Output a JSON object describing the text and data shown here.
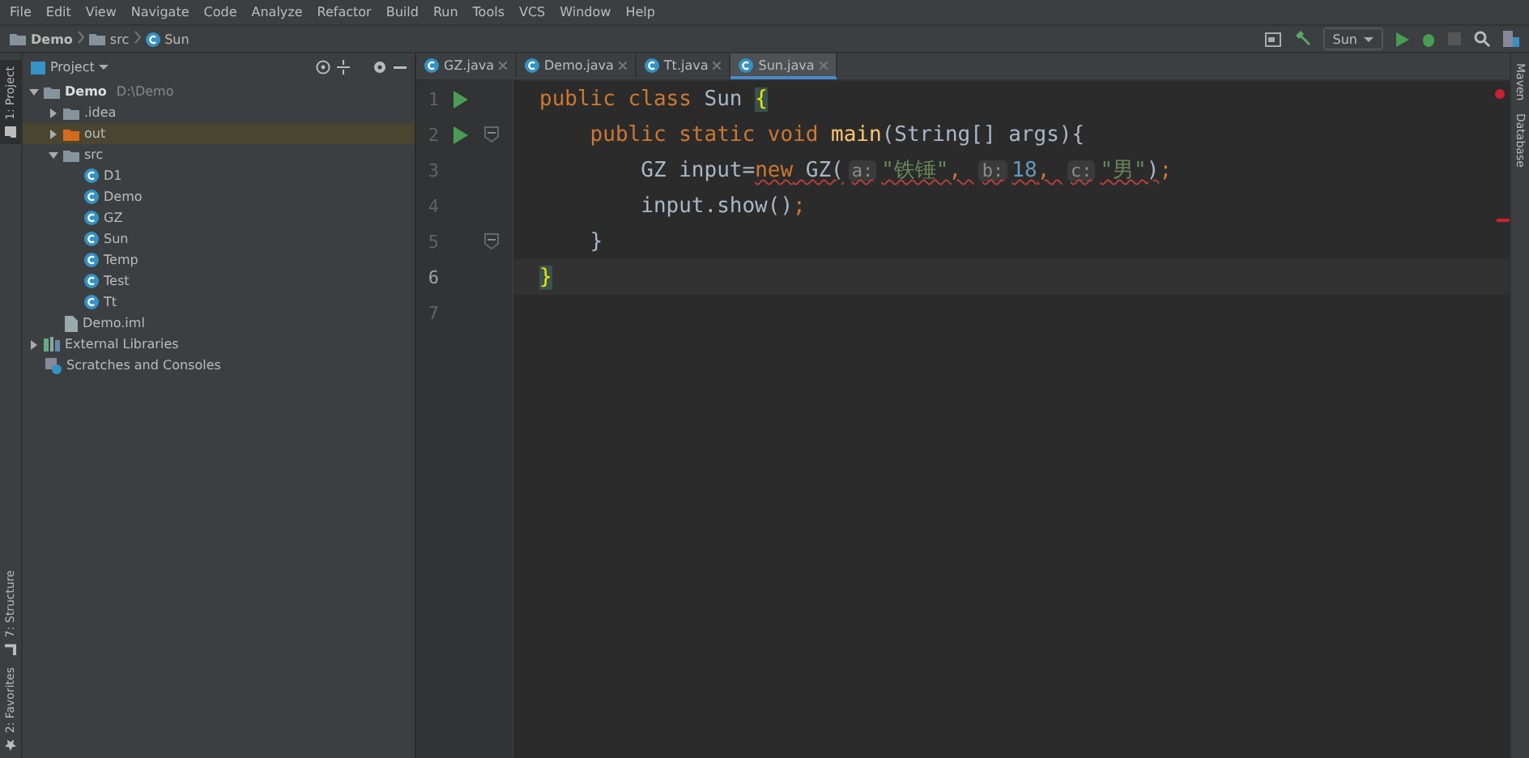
{
  "menu": [
    "File",
    "Edit",
    "View",
    "Navigate",
    "Code",
    "Analyze",
    "Refactor",
    "Build",
    "Run",
    "Tools",
    "VCS",
    "Window",
    "Help"
  ],
  "breadcrumb": [
    {
      "label": "Demo",
      "kind": "module"
    },
    {
      "label": "src",
      "kind": "folder"
    },
    {
      "label": "Sun",
      "kind": "class"
    }
  ],
  "run_config": "Sun",
  "left_stripe": [
    {
      "label": "1: Project",
      "selected": true,
      "kind": "project"
    },
    {
      "label": "7: Structure",
      "selected": false,
      "kind": "structure"
    },
    {
      "label": "2: Favorites",
      "selected": false,
      "kind": "favorites"
    }
  ],
  "right_stripe": [
    "Maven",
    "Database"
  ],
  "project_panel": {
    "title": "Project",
    "tree": [
      {
        "label": "Demo",
        "path": "D:\\Demo",
        "kind": "module",
        "expanded": true,
        "selected": false,
        "children": [
          {
            "label": ".idea",
            "kind": "folder",
            "expanded": false,
            "selected": false
          },
          {
            "label": "out",
            "kind": "excluded",
            "expanded": false,
            "selected": true
          },
          {
            "label": "src",
            "kind": "folder",
            "expanded": true,
            "selected": false,
            "children": [
              {
                "label": "D1",
                "kind": "class",
                "selected": false
              },
              {
                "label": "Demo",
                "kind": "class",
                "selected": false
              },
              {
                "label": "GZ",
                "kind": "class",
                "selected": false
              },
              {
                "label": "Sun",
                "kind": "class",
                "selected": false
              },
              {
                "label": "Temp",
                "kind": "class",
                "selected": false
              },
              {
                "label": "Test",
                "kind": "class",
                "selected": false
              },
              {
                "label": "Tt",
                "kind": "class",
                "selected": false
              }
            ]
          },
          {
            "label": "Demo.iml",
            "kind": "file",
            "selected": false
          }
        ]
      },
      {
        "label": "External Libraries",
        "kind": "library",
        "expanded": false,
        "selected": false
      },
      {
        "label": "Scratches and Consoles",
        "kind": "scratches",
        "selected": false
      }
    ]
  },
  "tabs": [
    {
      "label": "GZ.java",
      "selected": false
    },
    {
      "label": "Demo.java",
      "selected": false
    },
    {
      "label": "Tt.java",
      "selected": false
    },
    {
      "label": "Sun.java",
      "selected": true
    }
  ],
  "editor": {
    "lines": [
      {
        "number": "1",
        "run": true,
        "fold": false,
        "current": false,
        "tokens": [
          {
            "kind": "keyword",
            "text": "public class "
          },
          {
            "kind": "plain",
            "text": "Sun "
          },
          {
            "kind": "brace",
            "text": "{"
          }
        ]
      },
      {
        "number": "2",
        "run": true,
        "fold": true,
        "current": false,
        "tokens": [
          {
            "kind": "keyword",
            "text": "    public static void "
          },
          {
            "kind": "method",
            "text": "main"
          },
          {
            "kind": "plain",
            "text": "(String[] args){"
          }
        ]
      },
      {
        "number": "3",
        "run": false,
        "fold": false,
        "current": false,
        "tokens": [
          {
            "kind": "plain",
            "text": "        GZ input="
          },
          {
            "kind": "keyword",
            "text": "new",
            "error": true
          },
          {
            "kind": "plain",
            "text": " GZ(",
            "error": true
          },
          {
            "kind": "hint",
            "text": "a:",
            "error": true
          },
          {
            "kind": "string",
            "text": "\"铁锤\"",
            "error": true
          },
          {
            "kind": "keyword",
            "text": ", ",
            "error": true
          },
          {
            "kind": "hint",
            "text": "b:",
            "error": true
          },
          {
            "kind": "number",
            "text": "18",
            "error": true
          },
          {
            "kind": "keyword",
            "text": ", ",
            "error": true
          },
          {
            "kind": "hint",
            "text": "c:",
            "error": true
          },
          {
            "kind": "string",
            "text": "\"男\"",
            "error": true
          },
          {
            "kind": "plain",
            "text": ")",
            "error": true
          },
          {
            "kind": "keyword",
            "text": ";"
          }
        ]
      },
      {
        "number": "4",
        "run": false,
        "fold": false,
        "current": false,
        "tokens": [
          {
            "kind": "plain",
            "text": "        input.show()"
          },
          {
            "kind": "keyword",
            "text": ";"
          }
        ]
      },
      {
        "number": "5",
        "run": false,
        "fold": true,
        "current": false,
        "tokens": [
          {
            "kind": "plain",
            "text": "    }"
          }
        ]
      },
      {
        "number": "6",
        "run": false,
        "fold": false,
        "current": true,
        "tokens": [
          {
            "kind": "brace",
            "text": "}"
          }
        ]
      },
      {
        "number": "7",
        "run": false,
        "fold": false,
        "current": false
      }
    ]
  }
}
